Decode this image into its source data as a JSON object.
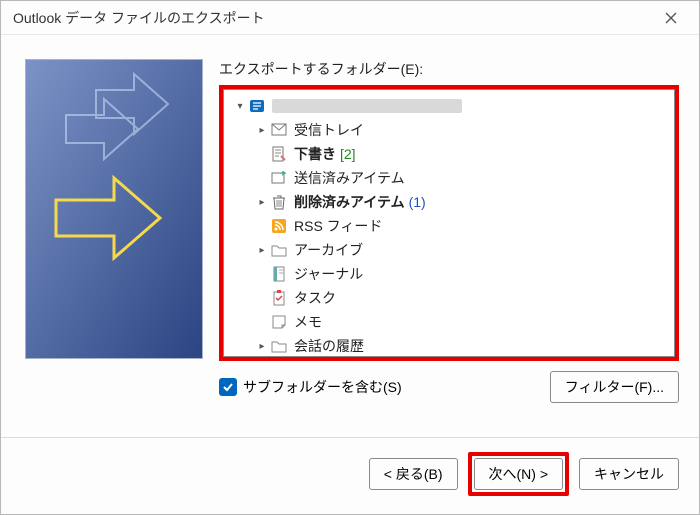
{
  "title": "Outlook データ ファイルのエクスポート",
  "field_label": "エクスポートするフォルダー(E):",
  "tree": {
    "root_blurred": "██████████████████████",
    "items": [
      {
        "label": "受信トレイ"
      },
      {
        "label": "下書き",
        "count_green": "[2]"
      },
      {
        "label": "送信済みアイテム"
      },
      {
        "label": "削除済みアイテム",
        "count_blue": "(1)"
      },
      {
        "label": "RSS フィード"
      },
      {
        "label": "アーカイブ"
      },
      {
        "label": "ジャーナル"
      },
      {
        "label": "タスク"
      },
      {
        "label": "メモ"
      },
      {
        "label": "会話の履歴"
      }
    ]
  },
  "include_subfolders": "サブフォルダーを含む(S)",
  "filter_btn": "フィルター(F)...",
  "back_btn": "< 戻る(B)",
  "next_btn": "次へ(N) >",
  "cancel_btn": "キャンセル"
}
